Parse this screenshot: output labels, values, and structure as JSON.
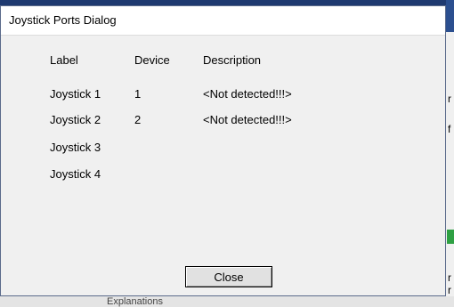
{
  "dialog": {
    "title": "Joystick Ports Dialog",
    "columns": {
      "label": "Label",
      "device": "Device",
      "description": "Description"
    },
    "rows": [
      {
        "label": "Joystick 1",
        "device": "1",
        "description": "<Not detected!!!>"
      },
      {
        "label": "Joystick 2",
        "device": "2",
        "description": "<Not detected!!!>"
      },
      {
        "label": "Joystick 3",
        "device": "",
        "description": ""
      },
      {
        "label": "Joystick 4",
        "device": "",
        "description": ""
      }
    ],
    "close_label": "Close"
  },
  "background": {
    "right_fragments": [
      "r",
      "f",
      "r",
      "r"
    ],
    "bottom_fragment": "Explanations"
  }
}
